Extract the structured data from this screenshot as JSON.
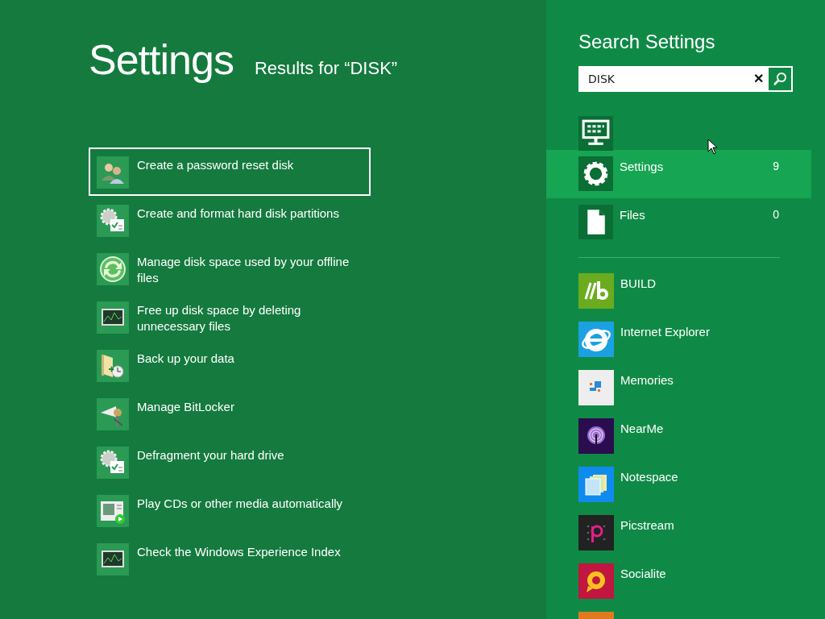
{
  "header": {
    "title": "Settings",
    "subtitle": "Results for “DISK”"
  },
  "results": [
    {
      "label": "Create a password reset disk",
      "kind": "users",
      "selected": true
    },
    {
      "label": "Create and format hard disk partitions",
      "kind": "tools",
      "selected": false
    },
    {
      "label": "Manage disk space used by your offline files",
      "kind": "sync",
      "selected": false
    },
    {
      "label": "Free up disk space by deleting unnecessary files",
      "kind": "monitor",
      "selected": false
    },
    {
      "label": "Back up your data",
      "kind": "backup",
      "selected": false
    },
    {
      "label": "Manage BitLocker",
      "kind": "lock",
      "selected": false
    },
    {
      "label": "Defragment your hard drive",
      "kind": "tools",
      "selected": false
    },
    {
      "label": "Play CDs or other media automatically",
      "kind": "media",
      "selected": false
    },
    {
      "label": "Check the Windows Experience Index",
      "kind": "monitor",
      "selected": false
    }
  ],
  "search_pane": {
    "title": "Search Settings",
    "search": {
      "value": "DISK",
      "clear": "✕"
    },
    "categories": [
      {
        "kind": "apps",
        "selected": false
      },
      {
        "kind": "settings",
        "label": "Settings",
        "count": "9",
        "selected": true
      },
      {
        "kind": "files",
        "label": "Files",
        "count": "0",
        "selected": false
      }
    ],
    "apps": [
      {
        "name": "BUILD",
        "kind": "build",
        "color": "#6aac1e"
      },
      {
        "name": "Internet Explorer",
        "kind": "ie",
        "color": "#1ba1e2"
      },
      {
        "name": "Memories",
        "kind": "memories",
        "color": "#eeeeee"
      },
      {
        "name": "NearMe",
        "kind": "nearme",
        "color": "#2a0d4e"
      },
      {
        "name": "Notespace",
        "kind": "notes",
        "color": "#0f8bf0"
      },
      {
        "name": "Picstream",
        "kind": "pic",
        "color": "#222222"
      },
      {
        "name": "Socialite",
        "kind": "social",
        "color": "#c0163f"
      },
      {
        "kind": "blank",
        "color": "#e07a20"
      }
    ]
  }
}
